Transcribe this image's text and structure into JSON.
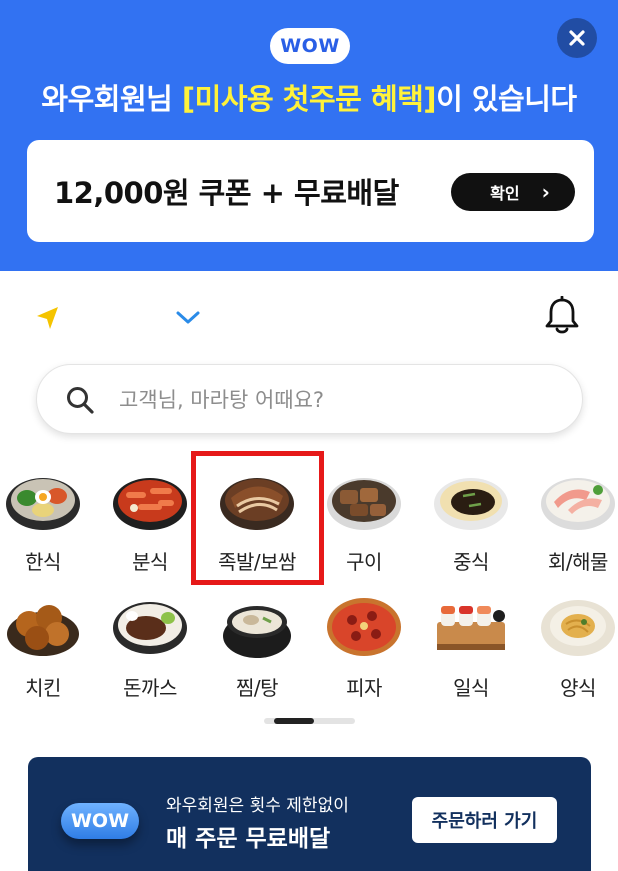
{
  "promo": {
    "badge": "WOW",
    "title_prefix": "와우회원님 ",
    "title_highlight": "[미사용 첫주문 혜택]",
    "title_suffix": "이 있습니다",
    "card_text": "12,000원 쿠폰 + 무료배달",
    "confirm_label": "확인",
    "confirm_chevron": "›",
    "close_glyph": "✕"
  },
  "search": {
    "placeholder": "고객님, 마라탕 어때요?"
  },
  "categories": {
    "items": [
      {
        "label": "한식",
        "icon": "bibimbap-icon"
      },
      {
        "label": "분식",
        "icon": "tteokbokki-icon"
      },
      {
        "label": "족발/보쌈",
        "icon": "jokbal-icon",
        "selected": true
      },
      {
        "label": "구이",
        "icon": "grilled-meat-icon"
      },
      {
        "label": "중식",
        "icon": "jajangmyeon-icon"
      },
      {
        "label": "회/해물",
        "icon": "sashimi-icon"
      },
      {
        "label": "치킨",
        "icon": "fried-chicken-icon"
      },
      {
        "label": "돈까스",
        "icon": "donkatsu-icon"
      },
      {
        "label": "찜/탕",
        "icon": "stew-pot-icon"
      },
      {
        "label": "피자",
        "icon": "pizza-icon"
      },
      {
        "label": "일식",
        "icon": "sushi-icon"
      },
      {
        "label": "양식",
        "icon": "pasta-icon"
      }
    ]
  },
  "pager": {
    "page": 1,
    "pages": 2
  },
  "wow_banner": {
    "badge": "WOW",
    "subtitle": "와우회원은 횟수 제한없이",
    "title": "매 주문 무료배달",
    "button_label": "주문하러 가기"
  },
  "colors": {
    "promo_bg": "#3272f2",
    "highlight_text": "#fff23a",
    "selected_border": "#e61919",
    "wow_banner_bg": "#12305e",
    "location_arrow": "#f5c400",
    "chevron": "#2a8be8"
  }
}
